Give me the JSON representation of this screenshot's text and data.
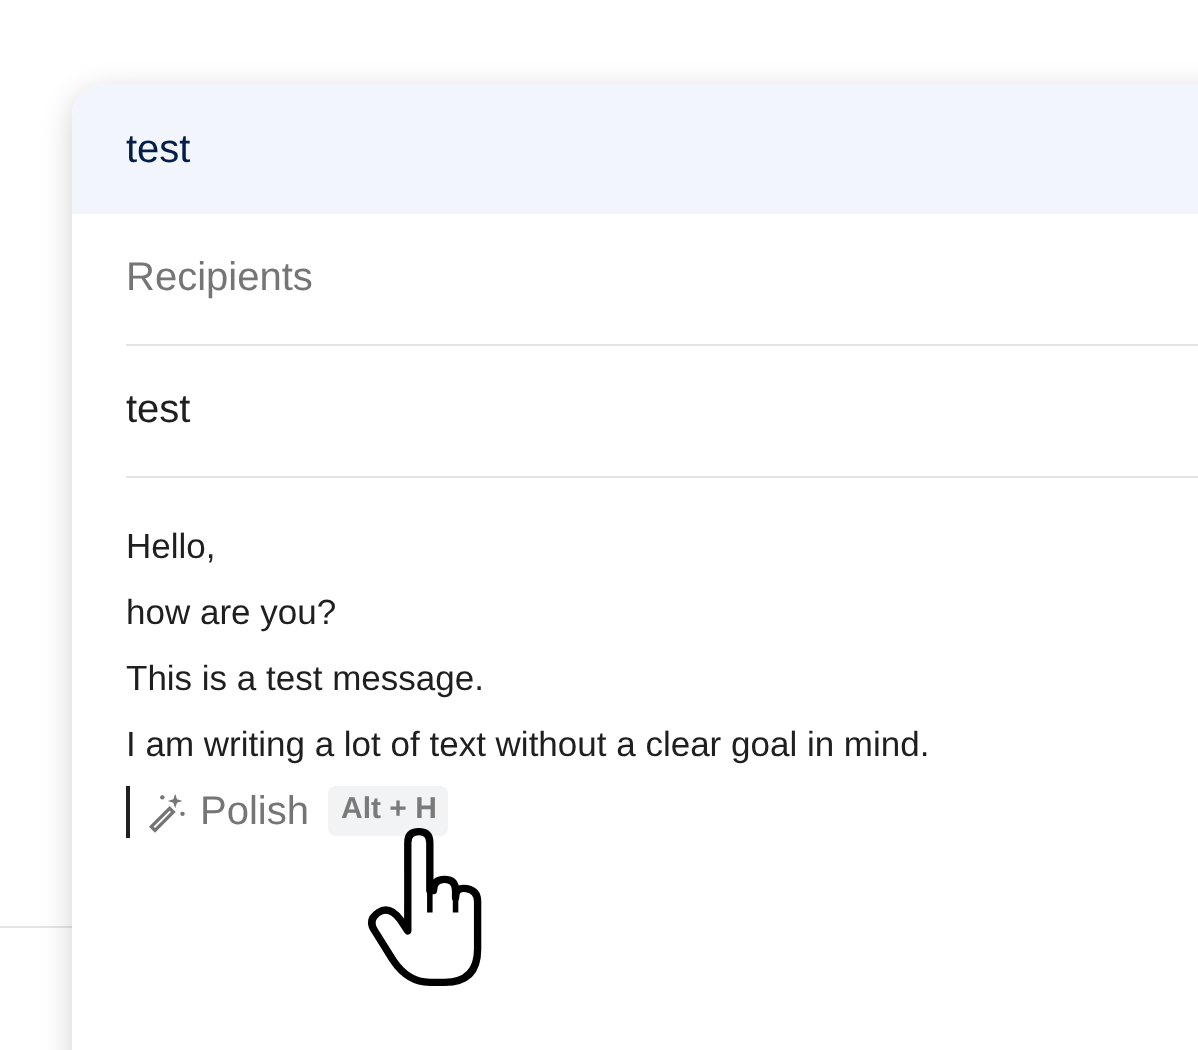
{
  "compose": {
    "title": "test",
    "recipients": {
      "placeholder": "Recipients"
    },
    "subject": "test",
    "body": [
      "Hello,",
      "how are you?",
      "This is a test message.",
      "I am writing a lot of text without a clear goal in mind."
    ],
    "suggestion": {
      "label": "Polish",
      "shortcut": "Alt + H"
    }
  }
}
